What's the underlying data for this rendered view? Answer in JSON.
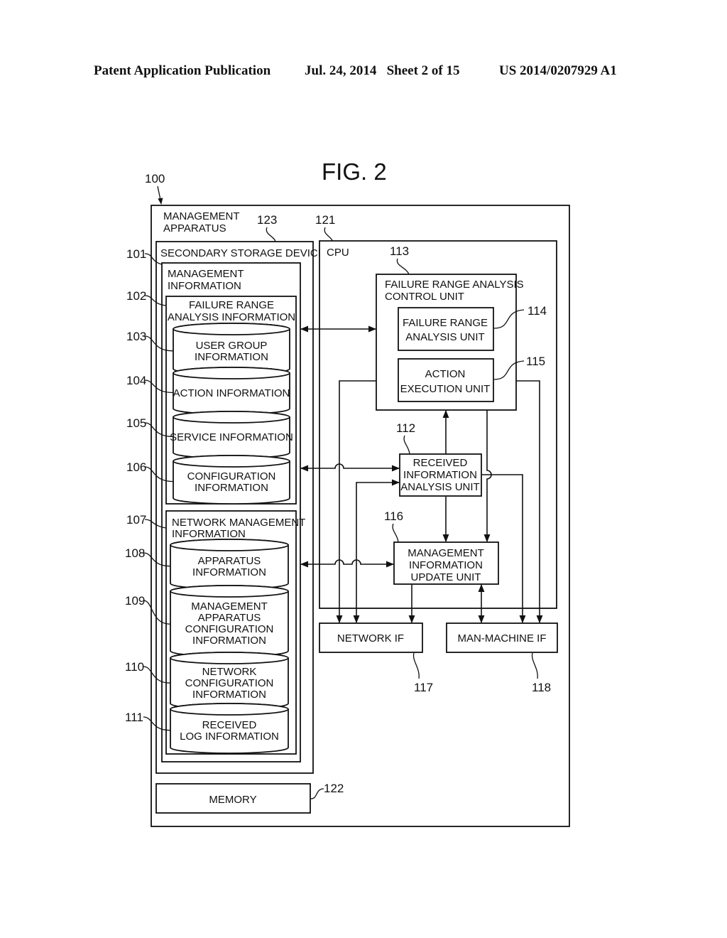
{
  "header": {
    "publication": "Patent Application Publication",
    "date_sheet": "Jul. 24, 2014   Sheet 2 of 15",
    "number": "US 2014/0207929 A1"
  },
  "figure": {
    "title": "FIG. 2",
    "apparatus": {
      "ref": "100",
      "line1": "MANAGEMENT",
      "line2": "APPARATUS"
    },
    "secondary_storage": {
      "ref": "123",
      "label": "SECONDARY STORAGE DEVICE"
    },
    "management_info": {
      "ref": "101",
      "line1": "MANAGEMENT",
      "line2": "INFORMATION"
    },
    "failure_range_info": {
      "ref": "102",
      "line1": "FAILURE RANGE",
      "line2": "ANALYSIS INFORMATION"
    },
    "databases": [
      {
        "ref": "103",
        "lines": [
          "USER GROUP",
          "INFORMATION"
        ]
      },
      {
        "ref": "104",
        "lines": [
          "ACTION INFORMATION"
        ]
      },
      {
        "ref": "105",
        "lines": [
          "SERVICE INFORMATION"
        ]
      },
      {
        "ref": "106",
        "lines": [
          "CONFIGURATION",
          "INFORMATION"
        ]
      },
      {
        "ref": "108",
        "lines": [
          "APPARATUS",
          "INFORMATION"
        ]
      },
      {
        "ref": "109",
        "lines": [
          "MANAGEMENT",
          "APPARATUS",
          "CONFIGURATION",
          "INFORMATION"
        ]
      },
      {
        "ref": "110",
        "lines": [
          "NETWORK",
          "CONFIGURATION",
          "INFORMATION"
        ]
      },
      {
        "ref": "111",
        "lines": [
          "RECEIVED",
          "LOG INFORMATION"
        ]
      }
    ],
    "network_mgmt_info": {
      "ref": "107",
      "line1": "NETWORK MANAGEMENT",
      "line2": "INFORMATION"
    },
    "memory": {
      "ref": "122",
      "label": "MEMORY"
    },
    "cpu": {
      "ref": "121",
      "label": "CPU"
    },
    "control_unit": {
      "ref": "113",
      "line1": "FAILURE RANGE ANALYSIS",
      "line2": "CONTROL UNIT"
    },
    "analysis_unit": {
      "ref": "114",
      "line1": "FAILURE RANGE",
      "line2": "ANALYSIS UNIT"
    },
    "action_unit": {
      "ref": "115",
      "line1": "ACTION",
      "line2": "EXECUTION UNIT"
    },
    "received_unit": {
      "ref": "112",
      "line1": "RECEIVED",
      "line2": "INFORMATION",
      "line3": "ANALYSIS UNIT"
    },
    "update_unit": {
      "ref": "116",
      "line1": "MANAGEMENT",
      "line2": "INFORMATION",
      "line3": "UPDATE UNIT"
    },
    "network_if": {
      "ref": "117",
      "label": "NETWORK IF"
    },
    "man_machine_if": {
      "ref": "118",
      "label": "MAN-MACHINE IF"
    }
  }
}
